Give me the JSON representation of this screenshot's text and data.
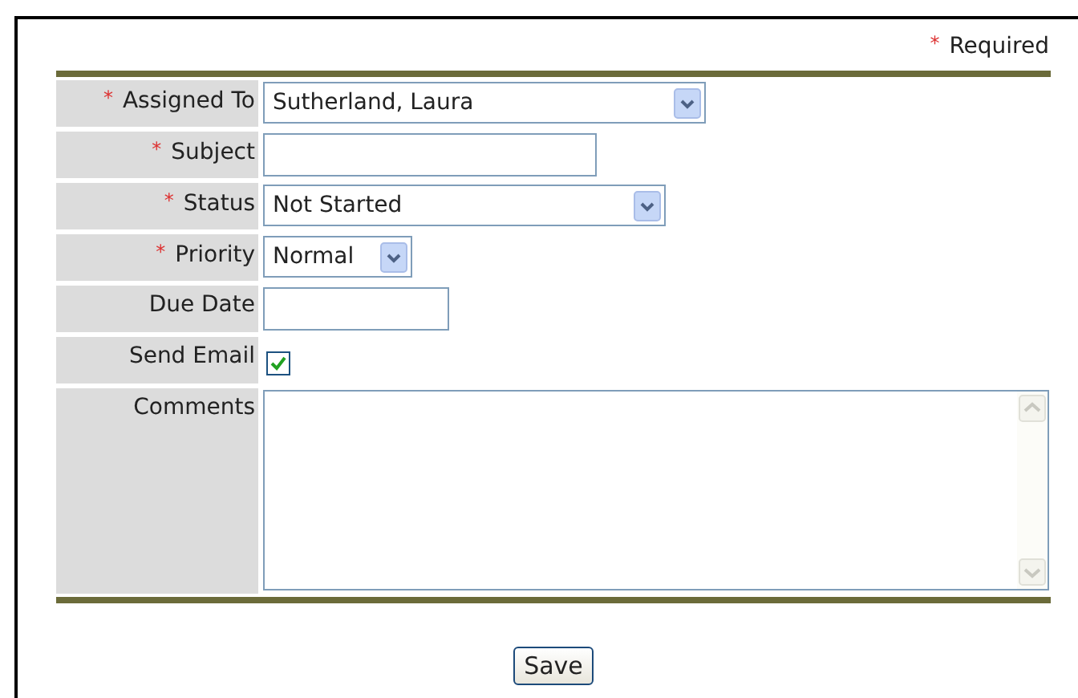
{
  "required_note": {
    "mark": "*",
    "label": "Required"
  },
  "fields": [
    {
      "label": "Assigned To",
      "required": true,
      "kind": "select",
      "value": "Sutherland, Laura"
    },
    {
      "label": "Subject",
      "required": true,
      "kind": "text"
    },
    {
      "label": "Status",
      "required": true,
      "kind": "select",
      "value": "Not Started"
    },
    {
      "label": "Priority",
      "required": true,
      "kind": "select",
      "value": "Normal"
    },
    {
      "label": "Due Date",
      "required": false,
      "kind": "text"
    },
    {
      "label": "Send Email",
      "required": false,
      "kind": "checkbox",
      "checked": true
    },
    {
      "label": "Comments",
      "required": false,
      "kind": "textarea"
    }
  ],
  "buttons": [
    "Save"
  ]
}
